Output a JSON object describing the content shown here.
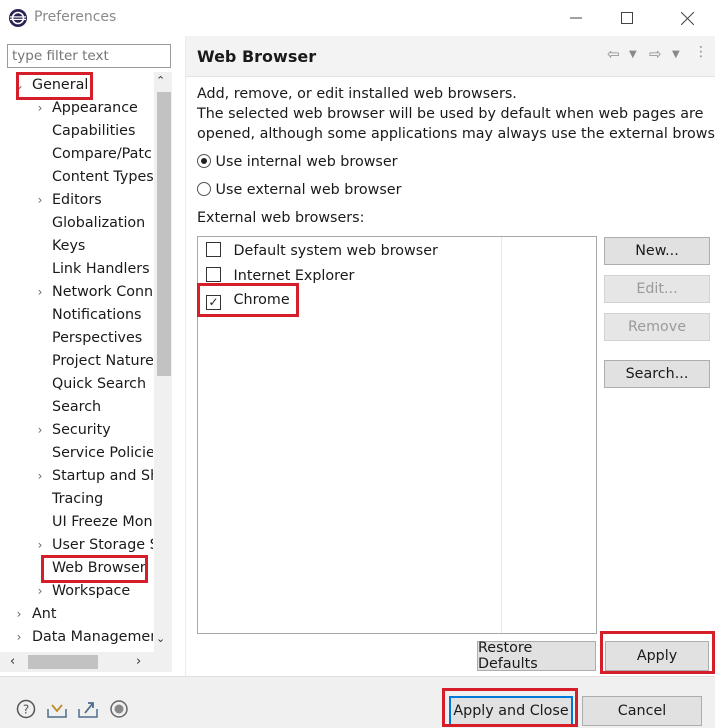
{
  "window": {
    "title": "Preferences"
  },
  "filter": {
    "placeholder": "type filter text"
  },
  "tree": {
    "items": [
      {
        "label": "General",
        "chev": "⌄"
      },
      {
        "label": "Appearance",
        "chev": "›"
      },
      {
        "label": "Capabilities",
        "chev": ""
      },
      {
        "label": "Compare/Patch",
        "chev": ""
      },
      {
        "label": "Content Types",
        "chev": ""
      },
      {
        "label": "Editors",
        "chev": "›"
      },
      {
        "label": "Globalization",
        "chev": ""
      },
      {
        "label": "Keys",
        "chev": ""
      },
      {
        "label": "Link Handlers",
        "chev": ""
      },
      {
        "label": "Network Connections",
        "chev": "›"
      },
      {
        "label": "Notifications",
        "chev": ""
      },
      {
        "label": "Perspectives",
        "chev": ""
      },
      {
        "label": "Project Natures",
        "chev": ""
      },
      {
        "label": "Quick Search",
        "chev": ""
      },
      {
        "label": "Search",
        "chev": ""
      },
      {
        "label": "Security",
        "chev": "›"
      },
      {
        "label": "Service Policies",
        "chev": ""
      },
      {
        "label": "Startup and Shutdown",
        "chev": "›"
      },
      {
        "label": "Tracing",
        "chev": ""
      },
      {
        "label": "UI Freeze Monitoring",
        "chev": ""
      },
      {
        "label": "User Storage Service",
        "chev": "›"
      },
      {
        "label": "Web Browser",
        "chev": "",
        "selected": true
      },
      {
        "label": "Workspace",
        "chev": "›"
      },
      {
        "label": "Ant",
        "chev": "›"
      },
      {
        "label": "Data Management",
        "chev": "›"
      }
    ]
  },
  "page": {
    "title": "Web Browser",
    "desc_line1": "Add, remove, or edit installed web browsers.",
    "desc_line2": "The selected web browser will be used by default when web pages are",
    "desc_line3": "opened, although some applications may always use the external browser.",
    "radio_internal": "Use internal web browser",
    "radio_external": "Use external web browser",
    "radio_selected": "internal",
    "list_label": "External web browsers:",
    "browsers": [
      {
        "name": "Default system web browser",
        "checked": false
      },
      {
        "name": "Internet Explorer",
        "checked": false
      },
      {
        "name": "Chrome",
        "checked": true
      }
    ],
    "buttons": {
      "new": "New...",
      "edit": "Edit...",
      "remove": "Remove",
      "search": "Search...",
      "restore": "Restore Defaults",
      "apply": "Apply"
    }
  },
  "footer": {
    "apply_close": "Apply and Close",
    "cancel": "Cancel"
  },
  "colors": {
    "highlight": "#d61d2a",
    "focus": "#0078d7"
  }
}
